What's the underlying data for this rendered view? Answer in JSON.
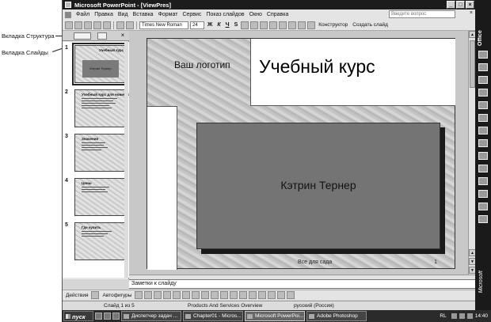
{
  "callouts": {
    "outline_tab": "Вкладка Структура",
    "slides_tab": "Вкладка Слайды"
  },
  "window": {
    "title": "Microsoft PowerPoint - [ViewPres]",
    "minimize": "_",
    "restore": "□",
    "close": "×"
  },
  "menu": {
    "items": [
      "Файл",
      "Правка",
      "Вид",
      "Вставка",
      "Формат",
      "Сервис",
      "Показ слайдов",
      "Окно",
      "Справка"
    ],
    "help_placeholder": "Введите вопрос",
    "close": "×"
  },
  "toolbar": {
    "font_name": "Times New Roman",
    "font_size": "24",
    "bold": "Ж",
    "italic": "К",
    "underline": "Ч",
    "shadow": "S",
    "designer_label": "Конструктор",
    "new_slide_label": "Создать слайд"
  },
  "panel": {
    "close": "×",
    "slides": [
      {
        "num": "1",
        "title": "Учебный курс",
        "subtitle": "Кэтрин Тернер"
      },
      {
        "num": "2",
        "title": "Учебный курс для новичков"
      },
      {
        "num": "3",
        "title": "Значения"
      },
      {
        "num": "4",
        "title": "Цены"
      },
      {
        "num": "5",
        "title": "Где купить"
      }
    ]
  },
  "slide": {
    "logo": "Ваш логотип",
    "title": "Учебный курс",
    "subtitle": "Кэтрин Тернер",
    "footer": "Все для сада",
    "number": "1"
  },
  "notes": {
    "placeholder": "Заметки к слайду"
  },
  "drawing": {
    "actions": "Действия",
    "autoshapes": "Автофигуры"
  },
  "status": {
    "slide_of": "Слайд 1 из 5",
    "design": "Products And Services Overview",
    "language": "русский (Россия)"
  },
  "office_bar": {
    "logo": "Office",
    "brand": "Microsoft"
  },
  "taskbar": {
    "start": "пуск",
    "tasks": [
      "Диспетчер задач ...",
      "Chapter01 - Micros...",
      "Microsoft PowerPoi...",
      "Adobe Photoshop"
    ],
    "lang": "RL",
    "time": "14:40"
  }
}
